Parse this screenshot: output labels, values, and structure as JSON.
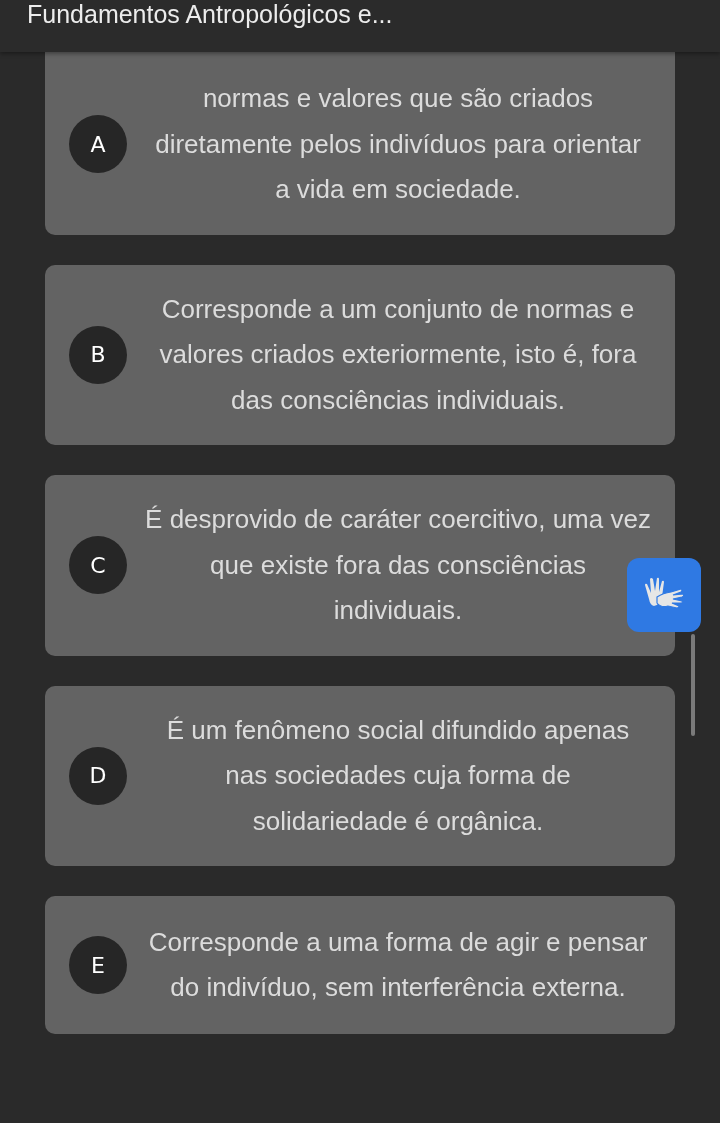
{
  "header": {
    "title": "Fundamentos Antropológicos e..."
  },
  "options": [
    {
      "letter": "A",
      "text": "normas e valores que são criados diretamente pelos indivíduos para orientar a vida em sociedade."
    },
    {
      "letter": "B",
      "text": "Corresponde a um conjunto de normas e valores criados exteriormente, isto é, fora das consciências individuais."
    },
    {
      "letter": "C",
      "text": "É desprovido de caráter coercitivo, uma vez que existe fora das consciências individuais."
    },
    {
      "letter": "D",
      "text": "É um fenômeno social difundido apenas nas sociedades cuja forma de solidariedade é orgânica."
    },
    {
      "letter": "E",
      "text": "Corresponde a uma forma de agir e pensar do indivíduo, sem interferência externa."
    }
  ]
}
